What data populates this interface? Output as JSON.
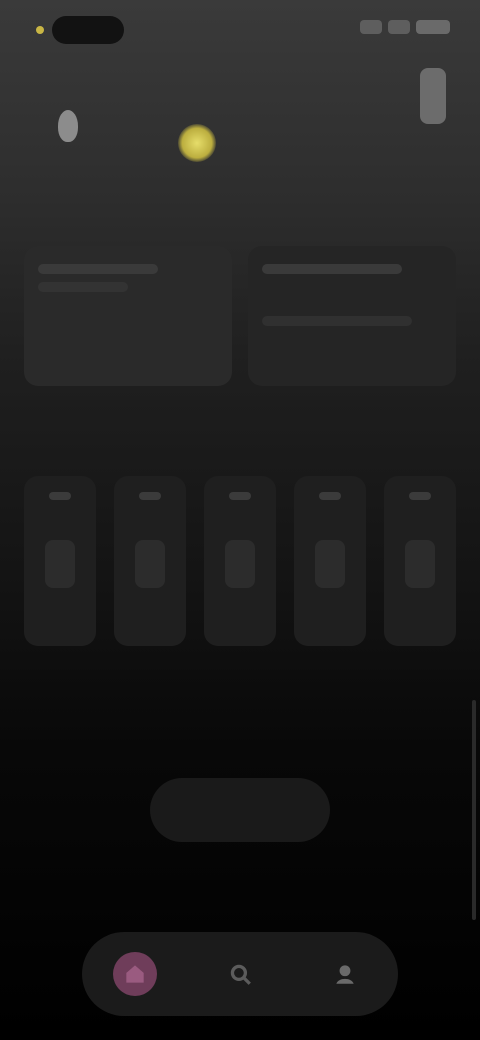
{
  "header": {
    "title": "",
    "subtitle": ""
  },
  "sections": {
    "section1_title": "",
    "card1": {
      "value": "",
      "caption": ""
    },
    "card2": {
      "value": "",
      "caption": ""
    },
    "section2_title": ""
  },
  "cta": {
    "label": ""
  },
  "nav": {
    "items": [
      {
        "name": "home",
        "icon": "home-icon",
        "active": true
      },
      {
        "name": "search",
        "icon": "search-icon",
        "active": false
      },
      {
        "name": "profile",
        "icon": "profile-icon",
        "active": false
      }
    ]
  },
  "colors": {
    "accent": "#6f3d5a",
    "sun": "#c9b645"
  }
}
